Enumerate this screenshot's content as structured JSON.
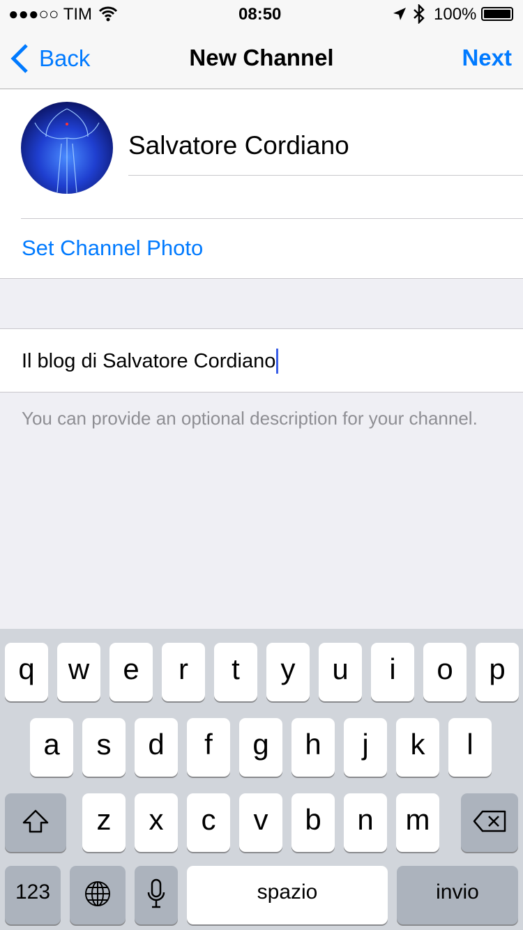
{
  "status": {
    "carrier": "●●●○○ TIM",
    "time": "08:50",
    "battery": "100%"
  },
  "nav": {
    "back": "Back",
    "title": "New Channel",
    "next": "Next"
  },
  "channel": {
    "name": "Salvatore Cordiano",
    "set_photo": "Set Channel Photo"
  },
  "description": {
    "value": "Il blog di Salvatore Cordiano",
    "hint": "You can provide an optional description for your channel."
  },
  "keyboard": {
    "row1": [
      "q",
      "w",
      "e",
      "r",
      "t",
      "y",
      "u",
      "i",
      "o",
      "p"
    ],
    "row2": [
      "a",
      "s",
      "d",
      "f",
      "g",
      "h",
      "j",
      "k",
      "l"
    ],
    "row3": [
      "z",
      "x",
      "c",
      "v",
      "b",
      "n",
      "m"
    ],
    "numbers": "123",
    "space": "spazio",
    "return": "invio"
  },
  "colors": {
    "accent": "#007aff",
    "cursor": "#3a5ee6"
  }
}
